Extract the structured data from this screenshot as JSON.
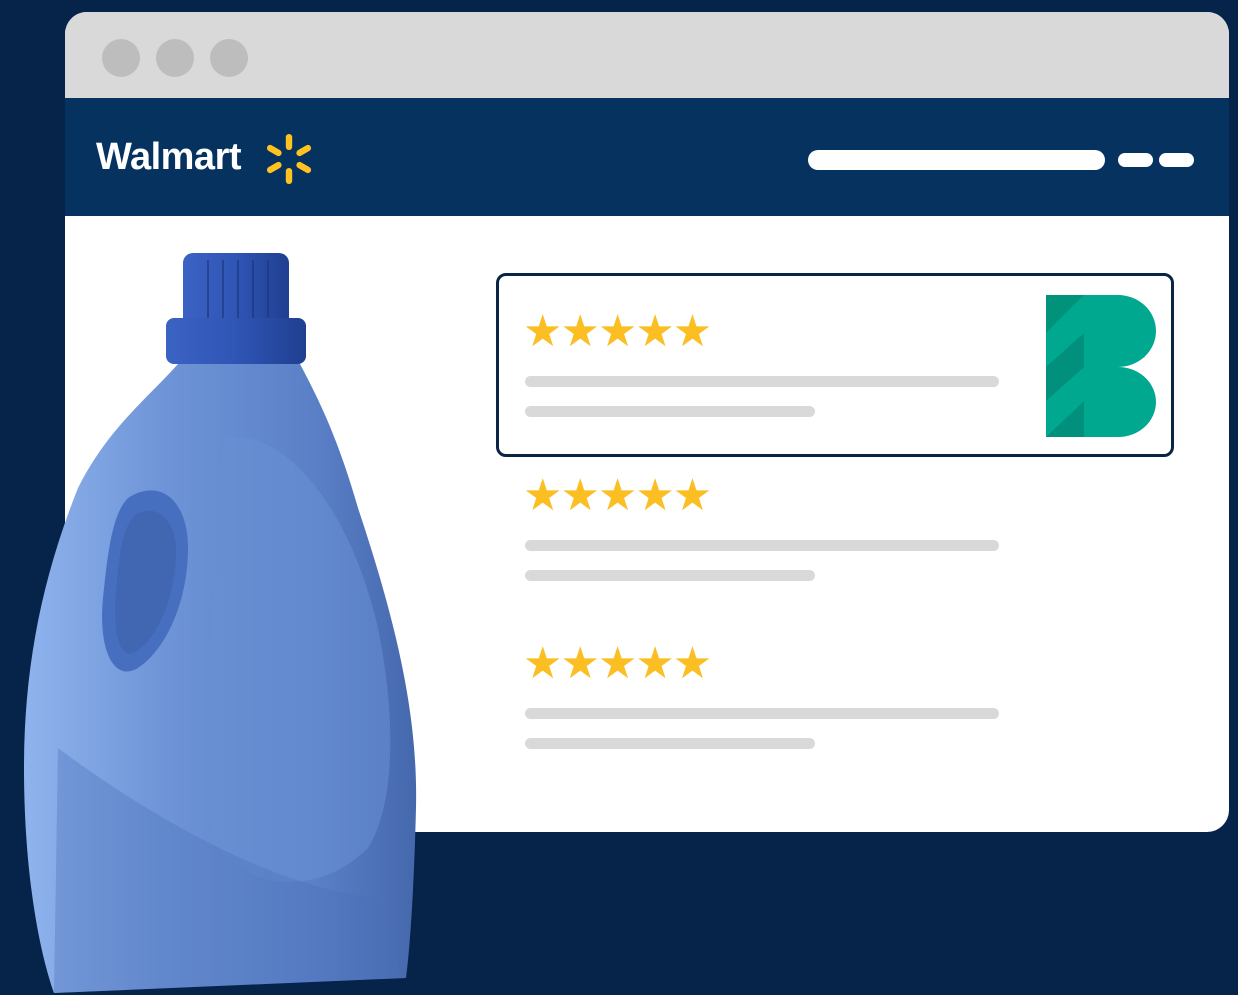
{
  "header": {
    "brand_name": "Walmart",
    "brand_color": "#05325f",
    "spark_color": "#ffc220"
  },
  "chrome": {
    "window_dots": [
      "dot",
      "dot",
      "dot"
    ]
  },
  "reviews": [
    {
      "rating": 5,
      "stars": "★★★★★",
      "highlighted": true,
      "badge_icon": "b-logo-icon"
    },
    {
      "rating": 5,
      "stars": "★★★★★",
      "highlighted": false
    },
    {
      "rating": 5,
      "stars": "★★★★★",
      "highlighted": false
    }
  ],
  "colors": {
    "background": "#06234a",
    "star": "#fbbf24",
    "badge": "#00a88f",
    "placeholder_line": "#d9d9d9"
  },
  "product": {
    "icon": "detergent-bottle-icon"
  }
}
